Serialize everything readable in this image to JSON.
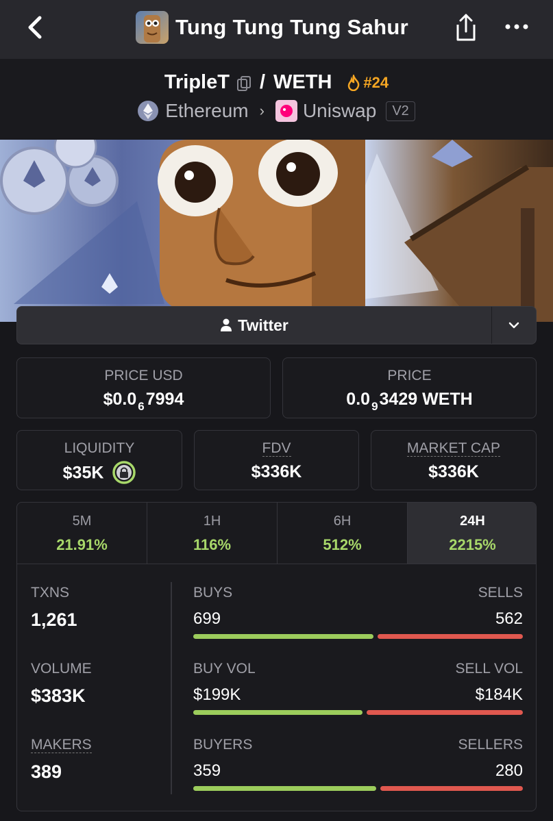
{
  "header": {
    "title": "Tung Tung Tung Sahur",
    "back_icon": "chevron-left-icon",
    "share_icon": "share-icon",
    "more_icon": "more-horizontal-icon"
  },
  "pair": {
    "base": "TripleT",
    "slash": "/",
    "quote": "WETH",
    "rank": "#24",
    "chain": "Ethereum",
    "dex": "Uniswap",
    "version": "V2"
  },
  "social": {
    "twitter_label": "Twitter"
  },
  "prices": {
    "price_usd_label": "PRICE USD",
    "price_usd_prefix": "$0.0",
    "price_usd_sub": "6",
    "price_usd_suffix": "7994",
    "price_label": "PRICE",
    "price_prefix": "0.0",
    "price_sub": "9",
    "price_suffix": "3429 WETH"
  },
  "metrics": {
    "liquidity_label": "LIQUIDITY",
    "liquidity_value": "$35K",
    "fdv_label": "FDV",
    "fdv_value": "$336K",
    "mcap_label": "MARKET CAP",
    "mcap_value": "$336K"
  },
  "tabs": [
    {
      "label": "5M",
      "value": "21.91%"
    },
    {
      "label": "1H",
      "value": "116%"
    },
    {
      "label": "6H",
      "value": "512%"
    },
    {
      "label": "24H",
      "value": "2215%"
    }
  ],
  "stats": {
    "txns_label": "TXNS",
    "txns_value": "1,261",
    "volume_label": "VOLUME",
    "volume_value": "$383K",
    "makers_label": "MAKERS",
    "makers_value": "389"
  },
  "ratios": {
    "buys_label": "BUYS",
    "buys_value": "699",
    "sells_label": "SELLS",
    "sells_value": "562",
    "buys_fraction": 0.554,
    "buyvol_label": "BUY VOL",
    "buyvol_value": "$199K",
    "sellvol_label": "SELL VOL",
    "sellvol_value": "$184K",
    "buyvol_fraction": 0.52,
    "buyers_label": "BUYERS",
    "buyers_value": "359",
    "sellers_label": "SELLERS",
    "sellers_value": "280",
    "buyers_fraction": 0.562
  },
  "colors": {
    "positive": "#a8d86a",
    "buy_bar": "#9ccc5c",
    "sell_bar": "#e0584f",
    "rank": "#f5a623"
  }
}
